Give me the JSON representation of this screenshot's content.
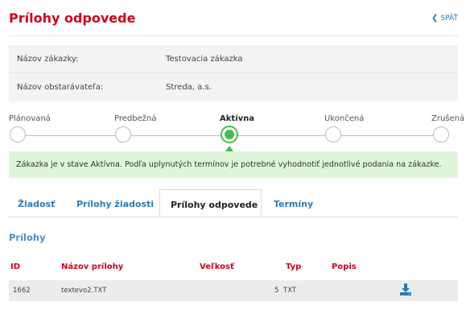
{
  "header": {
    "title": "Prílohy odpovede",
    "back_label": "SPÄŤ"
  },
  "info": [
    {
      "label": "Názov zákazky:",
      "value": "Testovacia zákazka"
    },
    {
      "label": "Názov obstarávateľa:",
      "value": "Streda, a.s."
    }
  ],
  "stepper": {
    "steps": [
      "Plánovaná",
      "Predbežná",
      "Aktívna",
      "Ukončená",
      "Zrušená"
    ],
    "active_index": 2,
    "accent_color": "#3fbf4a"
  },
  "status_message": "Zákazka je v stave Aktívna. Podľa uplynutých termínov je potrebné vyhodnotiť jednotlivé podania na zákazke.",
  "tabs": [
    {
      "label": "Žiadosť"
    },
    {
      "label": "Prílohy žiadosti"
    },
    {
      "label": "Prílohy odpovede"
    },
    {
      "label": "Termíny"
    }
  ],
  "active_tab": "Prílohy odpovede",
  "section_title": "Prílohy",
  "table": {
    "columns": [
      "ID",
      "Názov prílohy",
      "Veľkosť",
      "Typ",
      "Popis"
    ],
    "rows": [
      {
        "id": "1662",
        "name": "textevo2.TXT",
        "size": "5",
        "type": "TXT",
        "description": "",
        "action_icon": "download-icon"
      }
    ]
  },
  "colors": {
    "title": "#d0021b",
    "link": "#2a7ab8",
    "status_bg": "#dff5d9"
  }
}
